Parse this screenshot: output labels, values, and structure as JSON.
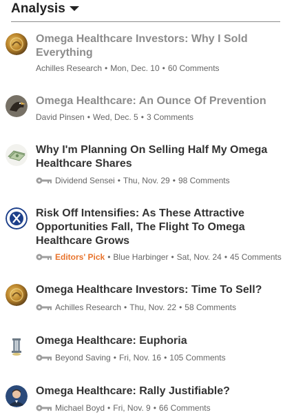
{
  "section": {
    "title": "Analysis"
  },
  "articles": [
    {
      "title": "Omega Healthcare Investors: Why I Sold Everything",
      "author": "Achilles Research",
      "date": "Mon, Dec. 10",
      "comments": "60 Comments",
      "visited": true,
      "author_icon": "gold-coin-avatar",
      "key_icon": false,
      "editors_pick": ""
    },
    {
      "title": "Omega Healthcare: An Ounce Of Prevention",
      "author": "David Pinsen",
      "date": "Wed, Dec. 5",
      "comments": "3 Comments",
      "visited": true,
      "author_icon": "eagle-avatar",
      "key_icon": false,
      "editors_pick": ""
    },
    {
      "title": "Why I'm Planning On Selling Half My Omega Healthcare Shares",
      "author": "Dividend Sensei",
      "date": "Thu, Nov. 29",
      "comments": "98 Comments",
      "visited": false,
      "author_icon": "money-avatar",
      "key_icon": true,
      "editors_pick": ""
    },
    {
      "title": "Risk Off Intensifies: As These Attractive Opportunities Fall, The Flight To Omega Healthcare Grows",
      "author": "Blue Harbinger",
      "date": "Sat, Nov. 24",
      "comments": "45 Comments",
      "visited": false,
      "author_icon": "blue-logo-avatar",
      "key_icon": true,
      "editors_pick": "Editors' Pick"
    },
    {
      "title": "Omega Healthcare Investors: Time To Sell?",
      "author": "Achilles Research",
      "date": "Thu, Nov. 22",
      "comments": "58 Comments",
      "visited": false,
      "author_icon": "gold-coin-avatar",
      "key_icon": true,
      "editors_pick": ""
    },
    {
      "title": "Omega Healthcare: Euphoria",
      "author": "Beyond Saving",
      "date": "Fri, Nov. 16",
      "comments": "105 Comments",
      "visited": false,
      "author_icon": "pillar-avatar",
      "key_icon": true,
      "editors_pick": ""
    },
    {
      "title": "Omega Healthcare: Rally Justifiable?",
      "author": "Michael Boyd",
      "date": "Fri, Nov. 9",
      "comments": "66 Comments",
      "visited": false,
      "author_icon": "person-avatar",
      "key_icon": true,
      "editors_pick": ""
    }
  ]
}
